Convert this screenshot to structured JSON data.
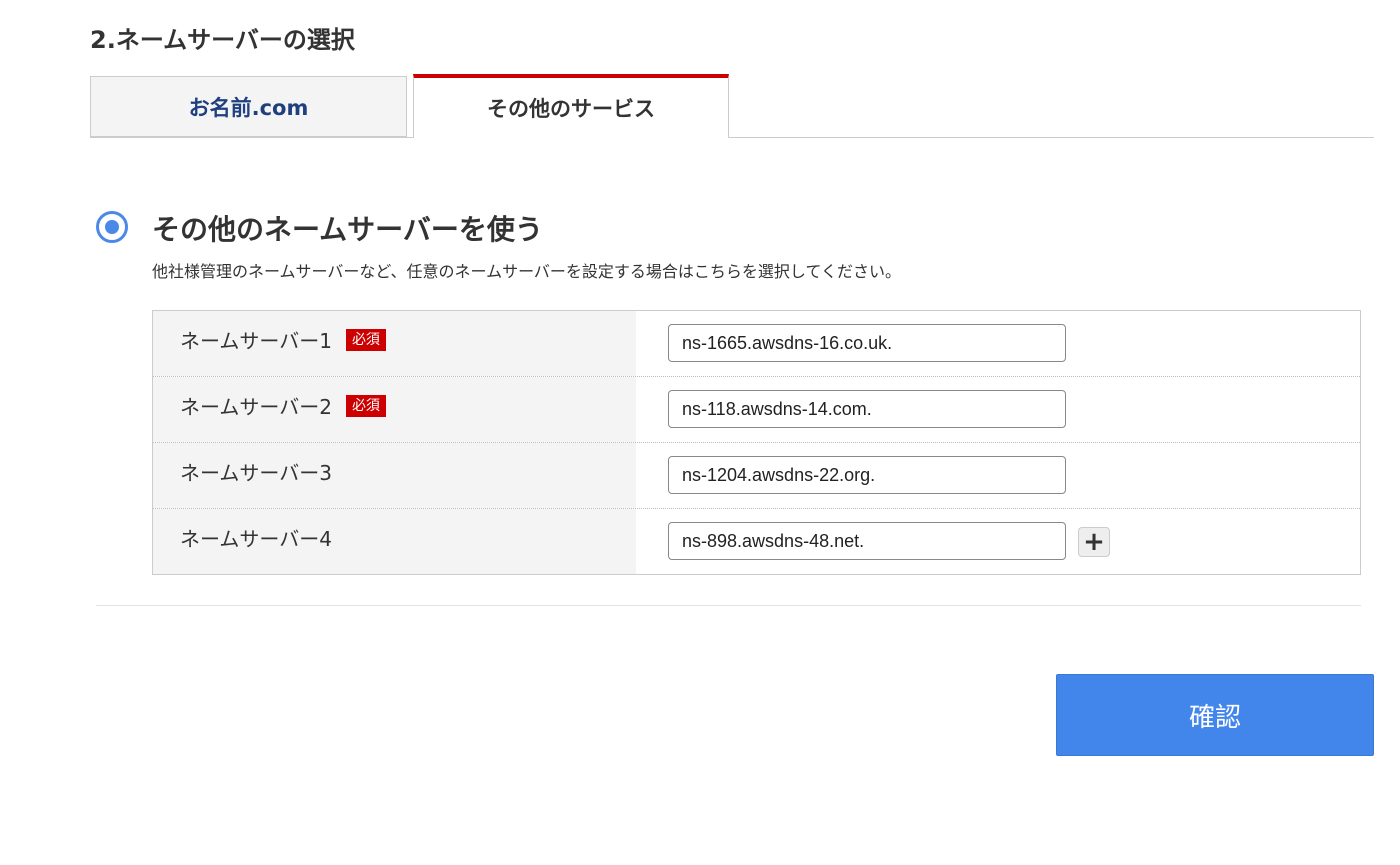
{
  "section": {
    "title": "2.ネームサーバーの選択"
  },
  "tabs": [
    {
      "label": "お名前.com",
      "active": false
    },
    {
      "label": "その他のサービス",
      "active": true
    }
  ],
  "option": {
    "title": "その他のネームサーバーを使う",
    "description": "他社様管理のネームサーバーなど、任意のネームサーバーを設定する場合はこちらを選択してください。",
    "selected": true
  },
  "nameservers": [
    {
      "label": "ネームサーバー1",
      "required_badge": "必須",
      "value": "ns-1665.awsdns-16.co.uk."
    },
    {
      "label": "ネームサーバー2",
      "required_badge": "必須",
      "value": "ns-118.awsdns-14.com."
    },
    {
      "label": "ネームサーバー3",
      "value": "ns-1204.awsdns-22.org."
    },
    {
      "label": "ネームサーバー4",
      "value": "ns-898.awsdns-48.net."
    }
  ],
  "add_button": {
    "label": "+",
    "icon": "plus-icon"
  },
  "confirm_button": {
    "label": "確認"
  },
  "colors": {
    "accent_blue": "#4286ec",
    "active_tab_border": "#cc0000",
    "required_badge": "#cc0000",
    "tab_text_blue": "#1f3f7f"
  }
}
